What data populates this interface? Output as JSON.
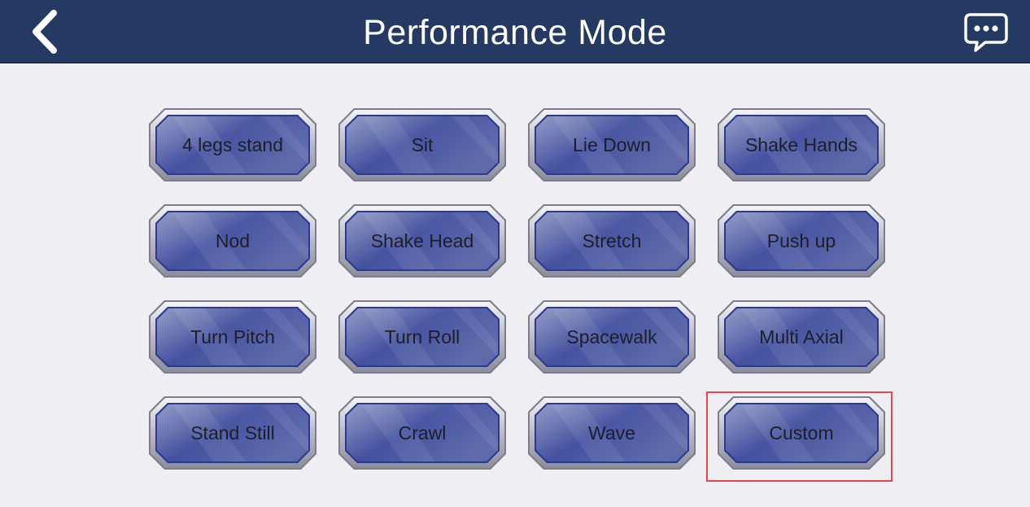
{
  "header": {
    "title": "Performance Mode",
    "back_icon": "chevron-left-icon",
    "chat_icon": "chat-bubble-icon"
  },
  "modes": [
    {
      "label": "4 legs stand"
    },
    {
      "label": "Sit"
    },
    {
      "label": "Lie Down"
    },
    {
      "label": "Shake Hands"
    },
    {
      "label": "Nod"
    },
    {
      "label": "Shake Head"
    },
    {
      "label": "Stretch"
    },
    {
      "label": "Push up"
    },
    {
      "label": "Turn Pitch"
    },
    {
      "label": "Turn Roll"
    },
    {
      "label": "Spacewalk"
    },
    {
      "label": "Multi Axial"
    },
    {
      "label": "Stand Still"
    },
    {
      "label": "Crawl"
    },
    {
      "label": "Wave"
    },
    {
      "label": "Custom",
      "highlighted": true
    }
  ],
  "colors": {
    "header_bg": "#243a63",
    "page_bg": "#efeff3",
    "button_face": "#3a4aa0",
    "highlight": "#e4484e"
  }
}
